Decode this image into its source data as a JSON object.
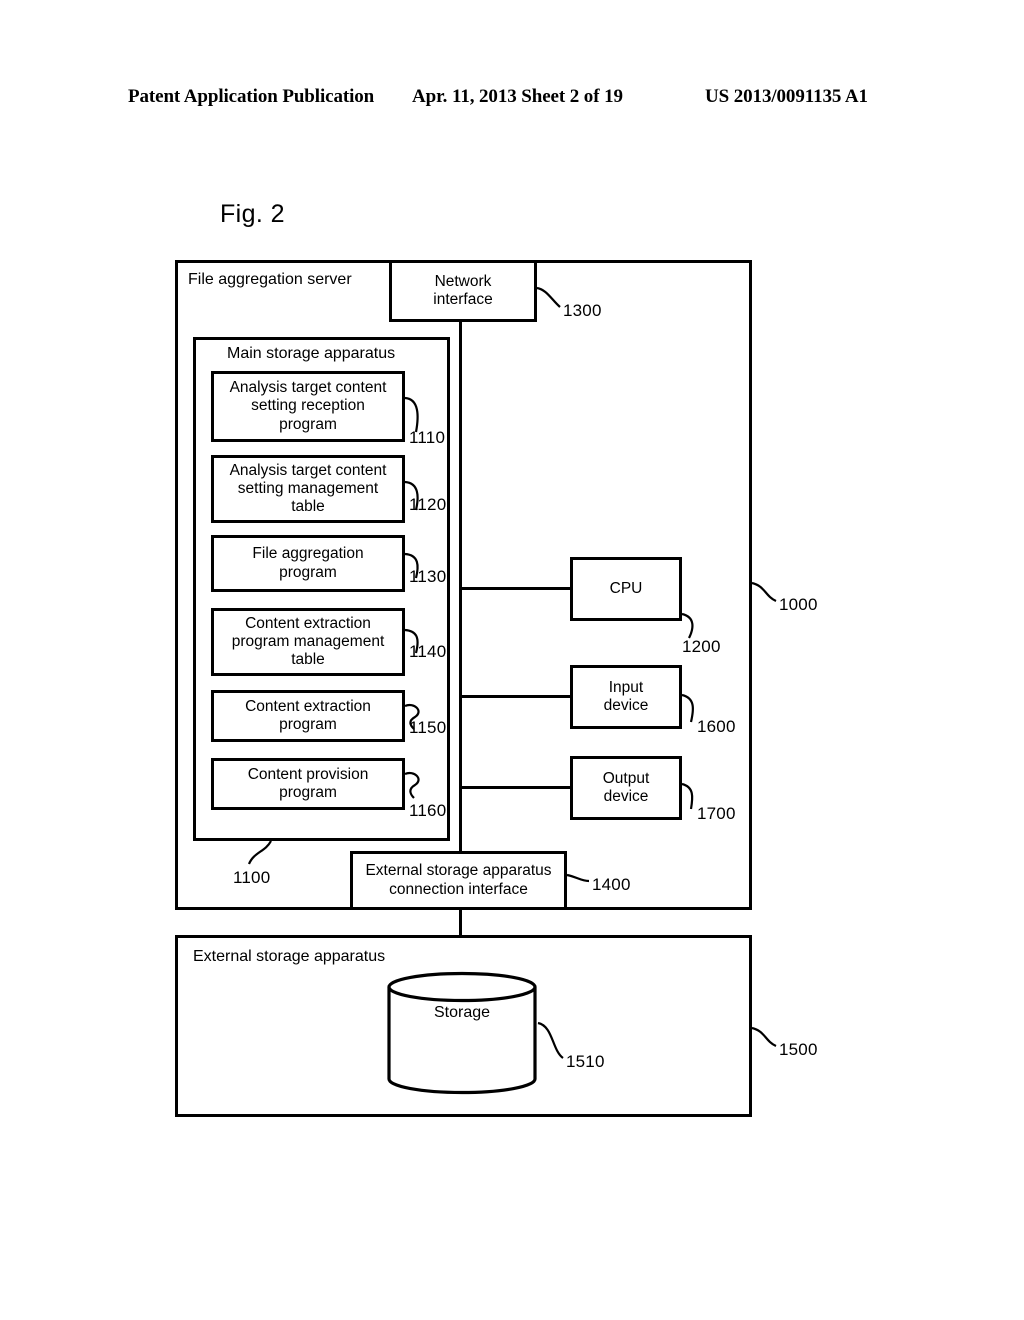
{
  "header": {
    "left": "Patent Application Publication",
    "middle": "Apr. 11, 2013  Sheet 2 of 19",
    "right": "US 2013/0091135 A1"
  },
  "figure": {
    "label": "Fig. 2"
  },
  "diagram": {
    "server": {
      "title": "File aggregation server",
      "ref": "1000"
    },
    "network_interface": {
      "label": "Network\ninterface",
      "ref": "1300"
    },
    "main_storage": {
      "title": "Main storage apparatus",
      "ref": "1100",
      "items": [
        {
          "label": "Analysis target content\nsetting reception\nprogram",
          "ref": "1110"
        },
        {
          "label": "Analysis target content\nsetting management\ntable",
          "ref": "1120"
        },
        {
          "label": "File aggregation\nprogram",
          "ref": "1130"
        },
        {
          "label": "Content extraction\nprogram management\ntable",
          "ref": "1140"
        },
        {
          "label": "Content extraction\nprogram",
          "ref": "1150"
        },
        {
          "label": "Content provision\nprogram",
          "ref": "1160"
        }
      ]
    },
    "cpu": {
      "label": "CPU",
      "ref": "1200"
    },
    "input_device": {
      "label": "Input\ndevice",
      "ref": "1600"
    },
    "output_device": {
      "label": "Output\ndevice",
      "ref": "1700"
    },
    "external_connection_interface": {
      "label": "External storage apparatus\nconnection interface",
      "ref": "1400"
    },
    "external_storage": {
      "title": "External storage apparatus",
      "ref": "1500"
    },
    "storage": {
      "label": "Storage",
      "ref": "1510"
    }
  }
}
